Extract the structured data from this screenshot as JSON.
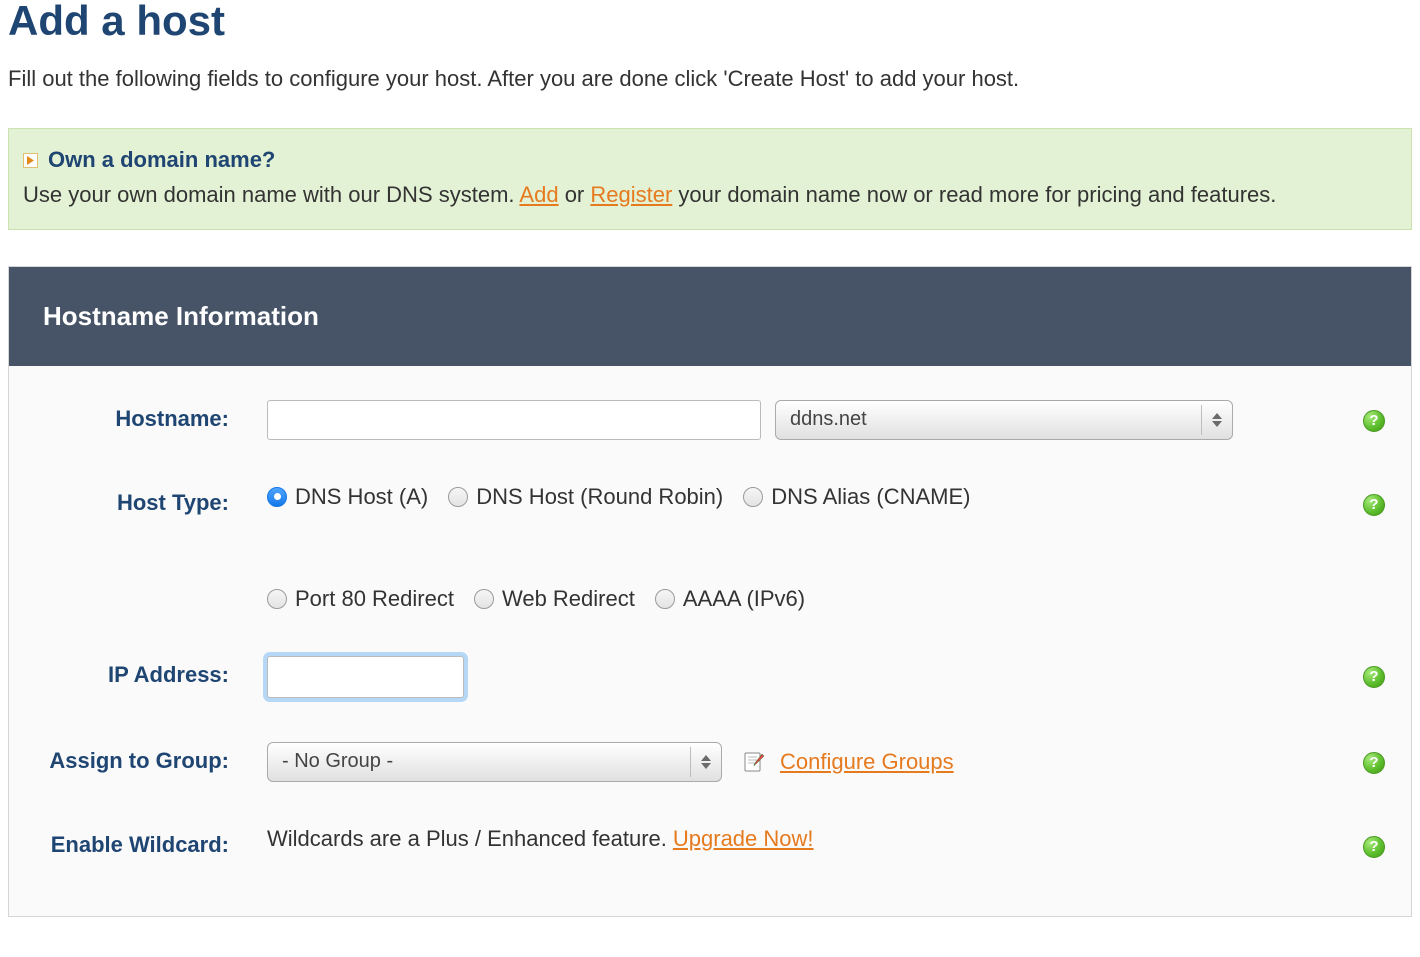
{
  "page": {
    "title": "Add a host",
    "subtitle": "Fill out the following fields to configure your host. After you are done click 'Create Host' to add your host."
  },
  "notice": {
    "title": "Own a domain name?",
    "body_prefix": "Use your own domain name with our DNS system. ",
    "add_label": "Add",
    "or_text": " or ",
    "register_label": "Register",
    "body_suffix": " your domain name now or read more for pricing and features."
  },
  "panel": {
    "header": "Hostname Information"
  },
  "form": {
    "hostname_label": "Hostname:",
    "hostname_value": "",
    "domain_selected": "ddns.net",
    "hosttype_label": "Host Type:",
    "hosttype_options": [
      {
        "label": "DNS Host (A)",
        "selected": true
      },
      {
        "label": "DNS Host (Round Robin)",
        "selected": false
      },
      {
        "label": "DNS Alias (CNAME)",
        "selected": false
      },
      {
        "label": "Port 80 Redirect",
        "selected": false
      },
      {
        "label": "Web Redirect",
        "selected": false
      },
      {
        "label": "AAAA (IPv6)",
        "selected": false
      }
    ],
    "ip_label": "IP Address:",
    "ip_value": "",
    "group_label": "Assign to Group:",
    "group_selected": "- No Group -",
    "configure_groups_label": "Configure Groups",
    "wildcard_label": "Enable Wildcard:",
    "wildcard_text": "Wildcards are a Plus / Enhanced feature. ",
    "upgrade_label": "Upgrade Now!"
  },
  "icons": {
    "help": "?"
  }
}
